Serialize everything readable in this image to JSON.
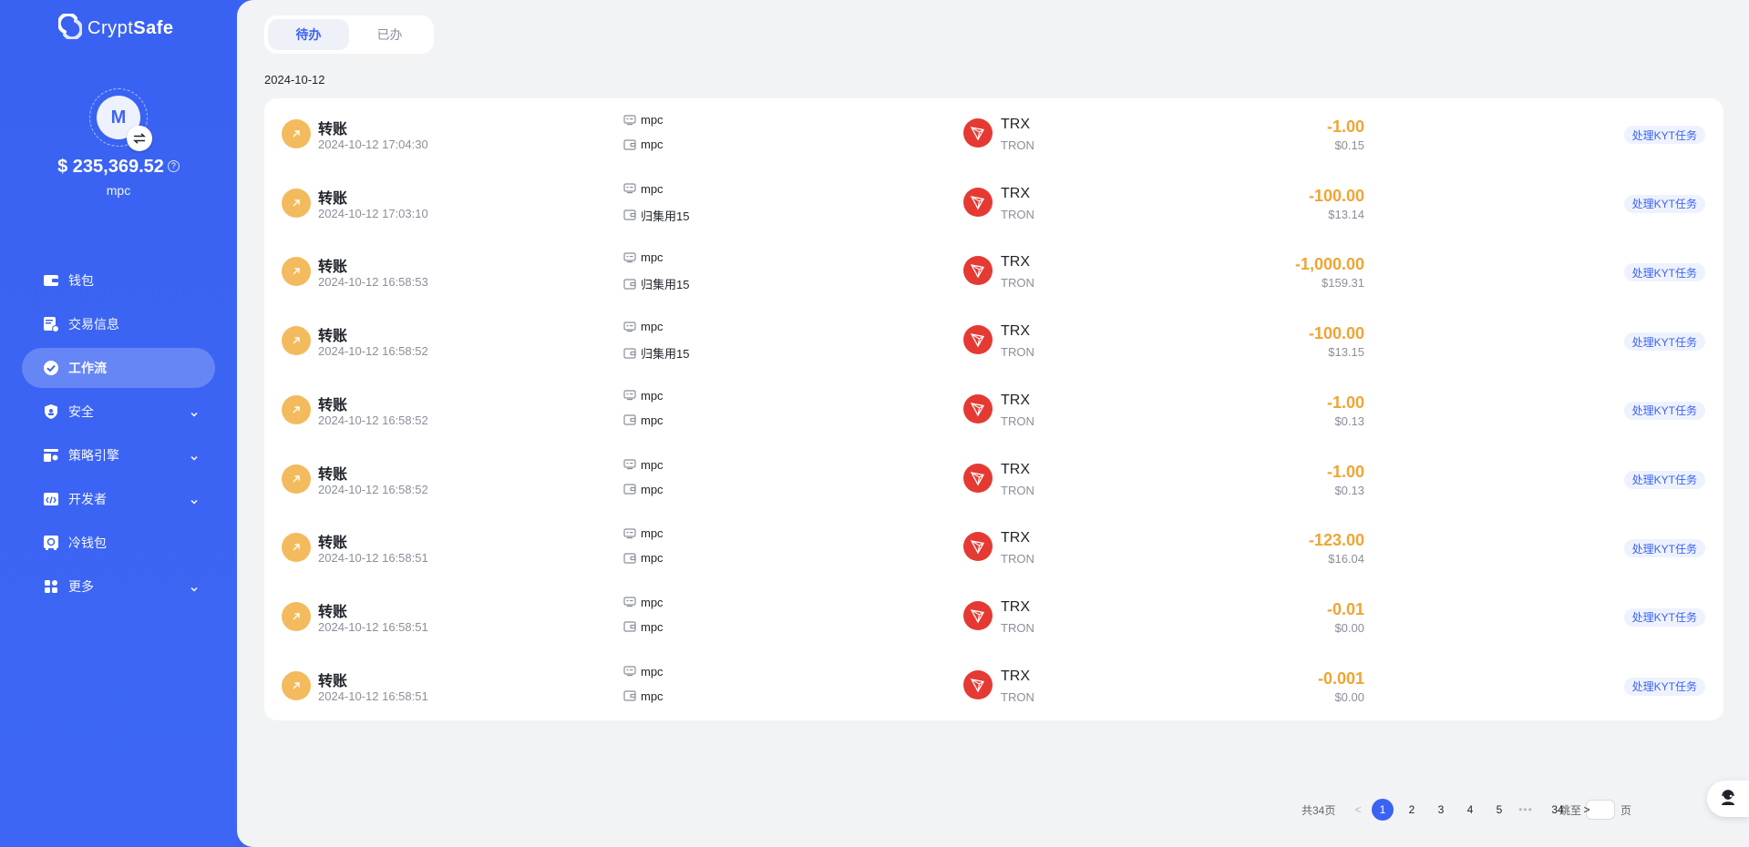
{
  "brand": {
    "name_light": "Crypt",
    "name_bold": "Safe"
  },
  "account": {
    "avatar_letter": "M",
    "balance": "$ 235,369.52",
    "help": "?",
    "wallet": "mpc"
  },
  "nav": [
    {
      "label": "钱包",
      "icon": "wallet-icon",
      "expandable": false,
      "active": false
    },
    {
      "label": "交易信息",
      "icon": "transaction-icon",
      "expandable": false,
      "active": false
    },
    {
      "label": "工作流",
      "icon": "check-circle-icon",
      "expandable": false,
      "active": true
    },
    {
      "label": "安全",
      "icon": "shield-icon",
      "expandable": true,
      "active": false
    },
    {
      "label": "策略引擎",
      "icon": "policy-icon",
      "expandable": true,
      "active": false
    },
    {
      "label": "开发者",
      "icon": "code-icon",
      "expandable": true,
      "active": false
    },
    {
      "label": "冷钱包",
      "icon": "safe-icon",
      "expandable": false,
      "active": false
    },
    {
      "label": "更多",
      "icon": "grid-icon",
      "expandable": true,
      "active": false
    }
  ],
  "tabs": [
    {
      "label": "待办",
      "active": true
    },
    {
      "label": "已办",
      "active": false
    }
  ],
  "date_heading": "2024-10-12",
  "rows": [
    {
      "type": "转账",
      "time": "2024-10-12 17:04:30",
      "from": "mpc",
      "to": "mpc",
      "symbol": "TRX",
      "chain": "TRON",
      "amount": "-1.00",
      "usd": "$0.15",
      "action": "处理KYT任务"
    },
    {
      "type": "转账",
      "time": "2024-10-12 17:03:10",
      "from": "mpc",
      "to": "归集用15",
      "symbol": "TRX",
      "chain": "TRON",
      "amount": "-100.00",
      "usd": "$13.14",
      "action": "处理KYT任务"
    },
    {
      "type": "转账",
      "time": "2024-10-12 16:58:53",
      "from": "mpc",
      "to": "归集用15",
      "symbol": "TRX",
      "chain": "TRON",
      "amount": "-1,000.00",
      "usd": "$159.31",
      "action": "处理KYT任务"
    },
    {
      "type": "转账",
      "time": "2024-10-12 16:58:52",
      "from": "mpc",
      "to": "归集用15",
      "symbol": "TRX",
      "chain": "TRON",
      "amount": "-100.00",
      "usd": "$13.15",
      "action": "处理KYT任务"
    },
    {
      "type": "转账",
      "time": "2024-10-12 16:58:52",
      "from": "mpc",
      "to": "mpc",
      "symbol": "TRX",
      "chain": "TRON",
      "amount": "-1.00",
      "usd": "$0.13",
      "action": "处理KYT任务"
    },
    {
      "type": "转账",
      "time": "2024-10-12 16:58:52",
      "from": "mpc",
      "to": "mpc",
      "symbol": "TRX",
      "chain": "TRON",
      "amount": "-1.00",
      "usd": "$0.13",
      "action": "处理KYT任务"
    },
    {
      "type": "转账",
      "time": "2024-10-12 16:58:51",
      "from": "mpc",
      "to": "mpc",
      "symbol": "TRX",
      "chain": "TRON",
      "amount": "-123.00",
      "usd": "$16.04",
      "action": "处理KYT任务"
    },
    {
      "type": "转账",
      "time": "2024-10-12 16:58:51",
      "from": "mpc",
      "to": "mpc",
      "symbol": "TRX",
      "chain": "TRON",
      "amount": "-0.01",
      "usd": "$0.00",
      "action": "处理KYT任务"
    },
    {
      "type": "转账",
      "time": "2024-10-12 16:58:51",
      "from": "mpc",
      "to": "mpc",
      "symbol": "TRX",
      "chain": "TRON",
      "amount": "-0.001",
      "usd": "$0.00",
      "action": "处理KYT任务"
    }
  ],
  "pagination": {
    "total": "共34页",
    "prev": "<",
    "pages": [
      "1",
      "2",
      "3",
      "4",
      "5"
    ],
    "active_page": "1",
    "ellipsis": "•••",
    "last": "34",
    "next": ">",
    "jump_label": "跳至",
    "page_suffix": "页"
  },
  "colors": {
    "primary": "#3b63f3",
    "amount": "#f0a432",
    "type_icon": "#f3bb5e",
    "coin_icon": "#e53a33"
  }
}
